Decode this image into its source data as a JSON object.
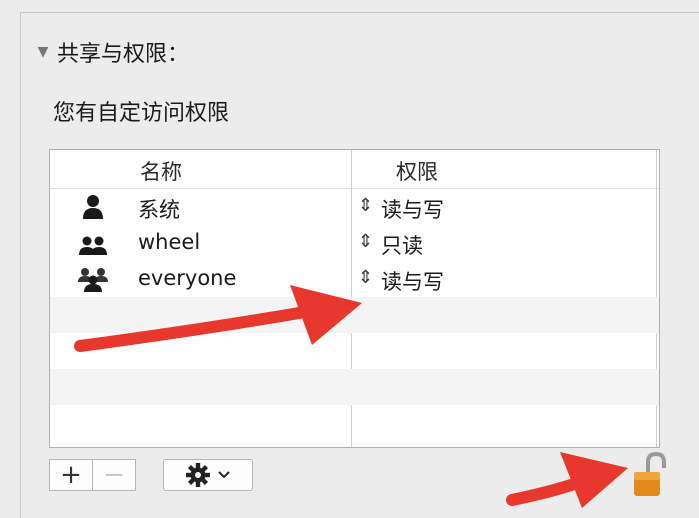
{
  "section": {
    "title": "共享与权限：",
    "access_note": "您有自定访问权限"
  },
  "table": {
    "columns": [
      "名称",
      "权限"
    ],
    "rows": [
      {
        "name": "系统",
        "permission": "读与写",
        "icon": "single-user-icon"
      },
      {
        "name": "wheel",
        "permission": "只读",
        "icon": "group-icon"
      },
      {
        "name": "everyone",
        "permission": "读与写",
        "icon": "everyone-icon"
      }
    ],
    "empty_rows": 3
  },
  "toolbar": {
    "add_label": "+",
    "remove_label": "−",
    "action_icon": "gear-icon",
    "lock_icon": "lock-open-icon"
  },
  "annotations": {
    "arrow_color": "#e8372c"
  }
}
